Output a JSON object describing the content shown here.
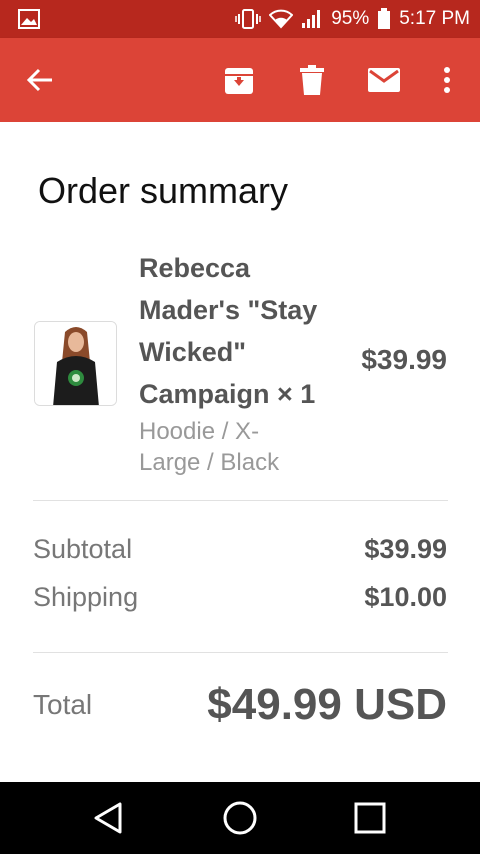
{
  "status_bar": {
    "battery": "95%",
    "time": "5:17 PM",
    "icons": [
      "image-notification-icon",
      "vibrate-icon",
      "wifi-icon",
      "signal-icon",
      "battery-icon"
    ]
  },
  "app_bar": {
    "color": "#dc4437",
    "actions": [
      "back-arrow-icon",
      "archive-icon",
      "delete-icon",
      "mail-icon",
      "more-vert-icon"
    ]
  },
  "order": {
    "title": "Order summary",
    "item": {
      "name": "Rebecca Mader's \"Stay Wicked\" Campaign × 1",
      "variant": "Hoodie / X-Large / Black",
      "price": "$39.99"
    },
    "subtotal_label": "Subtotal",
    "subtotal_value": "$39.99",
    "shipping_label": "Shipping",
    "shipping_value": "$10.00",
    "total_label": "Total",
    "total_value": "$49.99 USD"
  },
  "nav_bar": {
    "buttons": [
      "back-triangle-icon",
      "home-circle-icon",
      "recents-square-icon"
    ]
  }
}
